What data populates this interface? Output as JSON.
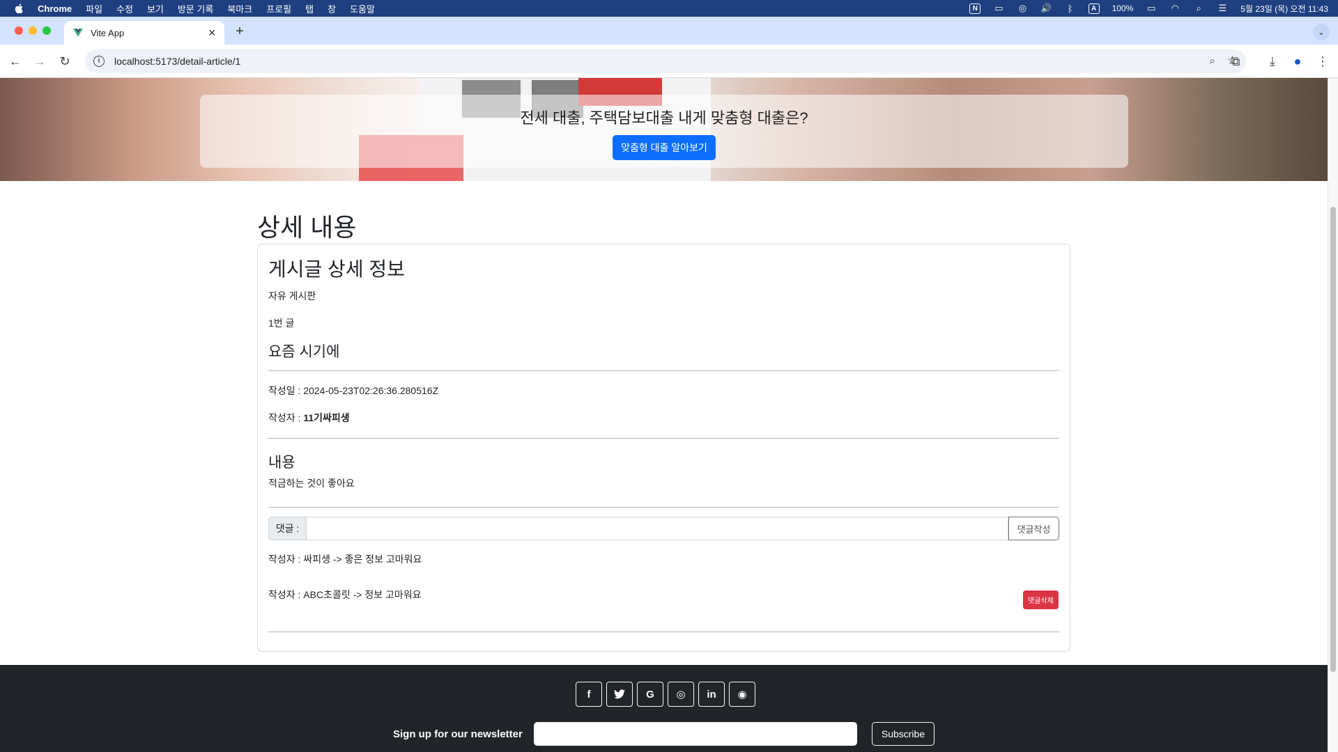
{
  "menubar": {
    "app": "Chrome",
    "items": [
      "파일",
      "수정",
      "보기",
      "방문 기록",
      "북마크",
      "프로필",
      "탭",
      "창",
      "도움말"
    ],
    "battery": "100%",
    "datetime": "5월 23일 (목) 오전 11:43"
  },
  "browser": {
    "tab_title": "Vite App",
    "url": "localhost:5173/detail-article/1"
  },
  "hero": {
    "title": "전세 대출, 주택담보대출 내게 맞춤형 대출은?",
    "button": "맞춤형 대출 알아보기",
    "slides": 3,
    "active_slide": 2
  },
  "page": {
    "heading": "상세 내용"
  },
  "article": {
    "card_title": "게시글 상세 정보",
    "board": "자유 게시판",
    "number": "1번 글",
    "subject": "요즘 시기에",
    "created_at": "작성일 : 2024-05-23T02:26:36.280516Z",
    "author_label": "작성자 : ",
    "author": "11기싸피생",
    "content_heading": "내용",
    "content": "적금하는 것이 좋아요"
  },
  "comments": {
    "label": "댓글 :",
    "submit": "댓글작성",
    "input_value": "",
    "items": [
      {
        "text": "작성자 : 싸피생 -> 좋은 정보 고마워요"
      },
      {
        "text": "작성자 : ABC초콜릿 -> 정보 고마워요",
        "delete_label": "댓글삭제"
      }
    ]
  },
  "footer": {
    "social": [
      {
        "icon": "facebook-icon",
        "glyph": "f"
      },
      {
        "icon": "twitter-icon",
        "glyph": "🐦"
      },
      {
        "icon": "google-icon",
        "glyph": "G"
      },
      {
        "icon": "instagram-icon",
        "glyph": "◎"
      },
      {
        "icon": "linkedin-icon",
        "glyph": "in"
      },
      {
        "icon": "github-icon",
        "glyph": "◉"
      }
    ],
    "newsletter_label": "Sign up for our newsletter",
    "subscribe": "Subscribe"
  },
  "colors": {
    "menubar": "#1f3f80",
    "primary": "#0d6efd",
    "danger": "#dc3545",
    "footer": "#212529"
  }
}
